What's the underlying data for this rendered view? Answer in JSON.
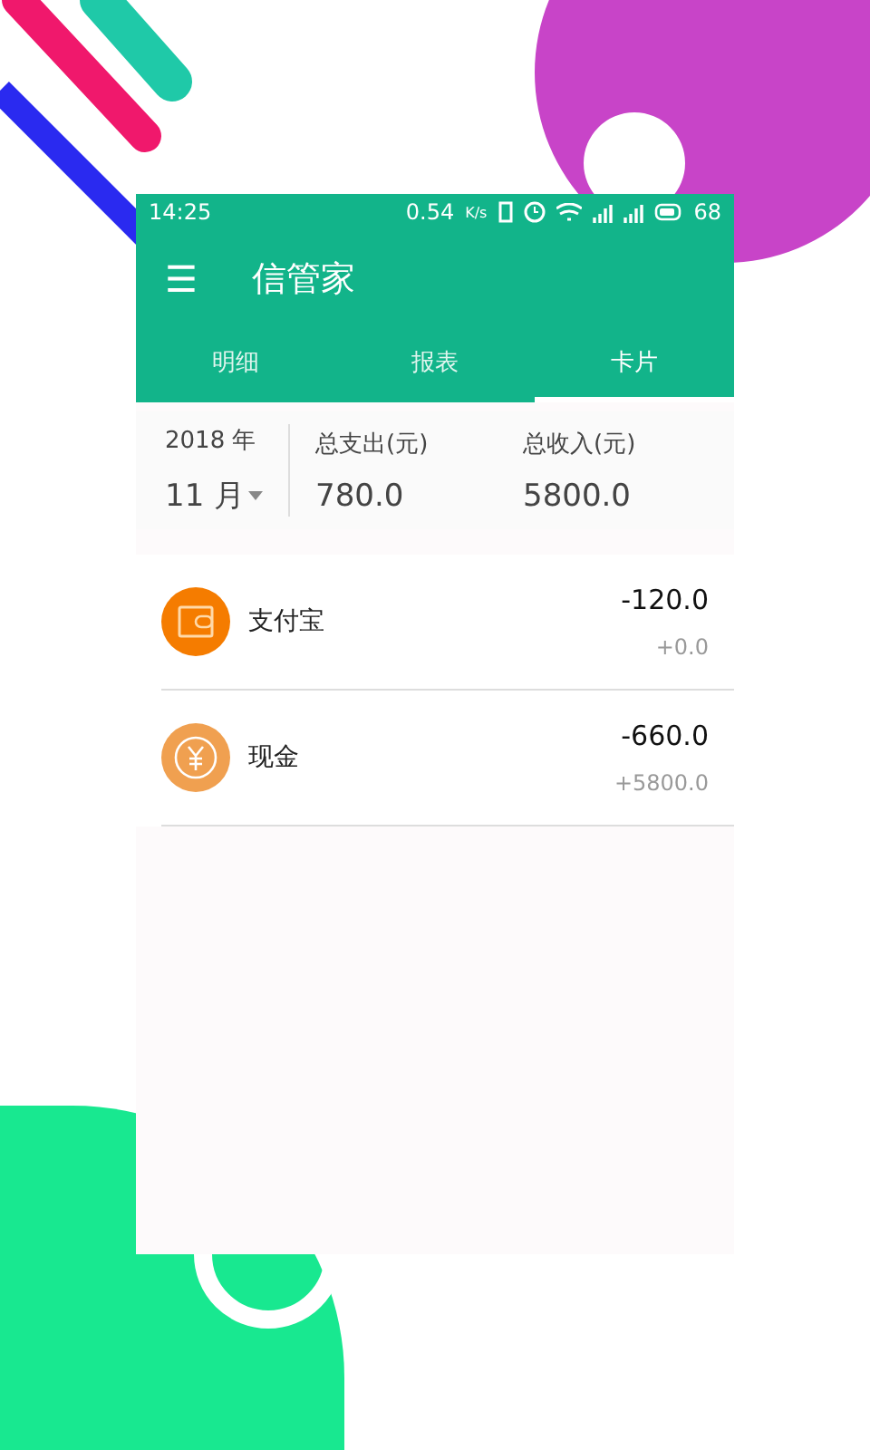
{
  "status_bar": {
    "time": "14:25",
    "speed": "0.54",
    "speed_unit": "K/s",
    "battery": "68"
  },
  "app_bar": {
    "menu_icon": "☰",
    "title": "信管家"
  },
  "tabs": [
    {
      "label": "明细",
      "selected": false
    },
    {
      "label": "报表",
      "selected": false
    },
    {
      "label": "卡片",
      "selected": true
    }
  ],
  "summary": {
    "year": "2018 年",
    "month": "11 月",
    "expense_label": "总支出(元)",
    "expense": "780.0",
    "income_label": "总收入(元)",
    "income": "5800.0"
  },
  "accounts": [
    {
      "kind": "wallet",
      "name": "支付宝",
      "expense": "-120.0",
      "income": "+0.0"
    },
    {
      "kind": "cash",
      "name": "现金",
      "expense": "-660.0",
      "income": "+5800.0"
    }
  ]
}
